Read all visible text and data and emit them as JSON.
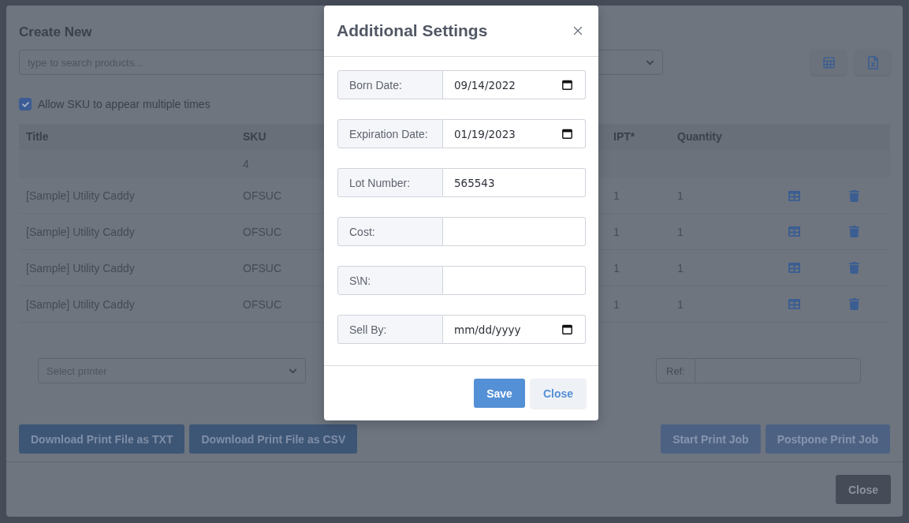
{
  "background_modal": {
    "title": "Create New",
    "search": {
      "placeholder": "type to search products..."
    },
    "allow_sku": {
      "label": "Allow SKU to appear multiple times",
      "checked": true
    },
    "table": {
      "columns": [
        "Title",
        "SKU",
        "IPT*",
        "Quantity"
      ],
      "summary": {
        "sku": "4"
      },
      "rows": [
        {
          "title": "[Sample] Utility Caddy",
          "sku": "OFSUC",
          "ipt": "1",
          "quantity": "1"
        },
        {
          "title": "[Sample] Utility Caddy",
          "sku": "OFSUC",
          "ipt": "1",
          "quantity": "1"
        },
        {
          "title": "[Sample] Utility Caddy",
          "sku": "OFSUC",
          "ipt": "1",
          "quantity": "1"
        },
        {
          "title": "[Sample] Utility Caddy",
          "sku": "OFSUC",
          "ipt": "1",
          "quantity": "1"
        }
      ]
    },
    "printer": {
      "placeholder": "Select printer"
    },
    "ref": {
      "label": "Ref:"
    },
    "download_buttons": [
      "Download Print File as TXT",
      "Download Print File as CSV"
    ],
    "job_buttons": [
      "Start Print Job",
      "Postpone Print Job"
    ],
    "footer_button": "Close"
  },
  "dialog": {
    "title": "Additional Settings",
    "fields": [
      {
        "label": "Born Date:",
        "kind": "date",
        "value": "09/14/2022"
      },
      {
        "label": "Expiration Date:",
        "kind": "date",
        "value": "01/19/2023"
      },
      {
        "label": "Lot Number:",
        "kind": "text",
        "value": "565543"
      },
      {
        "label": "Cost:",
        "kind": "text"
      },
      {
        "label": "S\\N:",
        "kind": "text"
      },
      {
        "label": "Sell By:",
        "kind": "date",
        "placeholder": "mm/dd/yyyy"
      }
    ],
    "buttons": [
      {
        "label": "Save",
        "kind": "primary"
      },
      {
        "label": "Close",
        "kind": "secondary"
      }
    ]
  }
}
